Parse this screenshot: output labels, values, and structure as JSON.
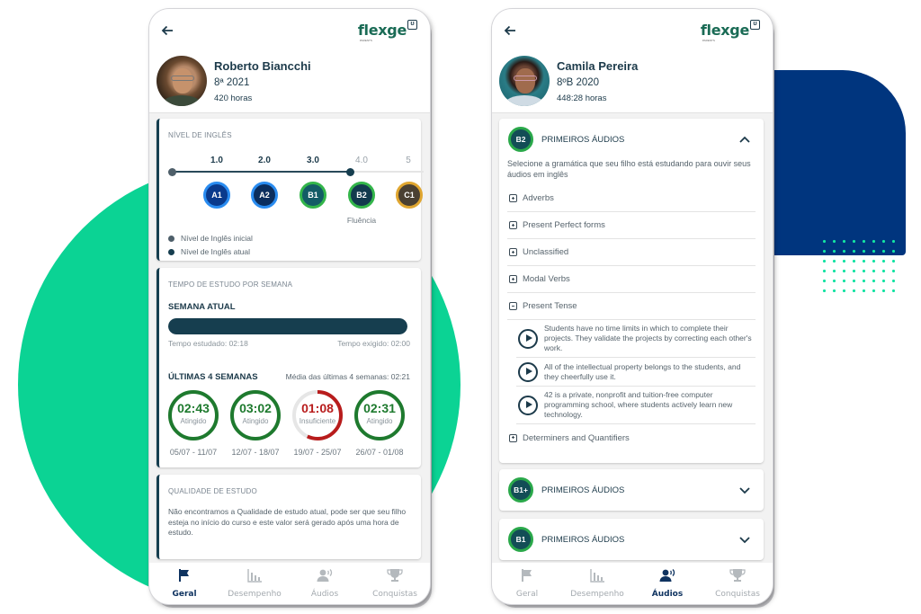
{
  "brand": {
    "logo_text": "flexge",
    "logo_sub": "PARENTS",
    "green": "#0bd394",
    "navy": "#00357e",
    "dark": "#163e4f"
  },
  "left_phone": {
    "user": {
      "name": "Roberto Biancchi",
      "class": "8ª 2021",
      "hours": "420 horas"
    },
    "level_card": {
      "title": "NÍVEL DE INGLÊS",
      "initial_level": 0.0,
      "current_level": 3.7,
      "scale": [
        "1.0",
        "2.0",
        "3.0",
        "4.0",
        "5"
      ],
      "levels": [
        {
          "code": "A1",
          "color": "#0a3a8c",
          "ring": "#2a8cf0"
        },
        {
          "code": "A2",
          "color": "#0b2e5e",
          "ring": "#2a8cf0"
        },
        {
          "code": "B1",
          "color": "#135c66",
          "ring": "#33b54a"
        },
        {
          "code": "B2",
          "color": "#123a4e",
          "ring": "#33b54a",
          "caption": "Fluência"
        },
        {
          "code": "C1",
          "color": "#4a4032",
          "ring": "#e0a630"
        }
      ],
      "legend": [
        {
          "label": "Nível de Inglês inicial",
          "color": "#4e5f6a"
        },
        {
          "label": "Nível de Inglês atual",
          "color": "#163e4f"
        }
      ]
    },
    "study_card": {
      "title": "TEMPO DE ESTUDO POR SEMANA",
      "current_week_label": "SEMANA ATUAL",
      "current_progress": 1.0,
      "studied": "Tempo estudado: 02:18",
      "required": "Tempo exigido: 02:00",
      "last_weeks_label": "ÚLTIMAS 4 SEMANAS",
      "average": "Média das últimas 4 semanas: 02:21",
      "weeks": [
        {
          "time": "02:43",
          "status": "Atingido",
          "range": "05/07 - 11/07",
          "progress": 1.0,
          "color": "#1e7a2e"
        },
        {
          "time": "03:02",
          "status": "Atingido",
          "range": "12/07 - 18/07",
          "progress": 1.0,
          "color": "#1e7a2e"
        },
        {
          "time": "01:08",
          "status": "Insuficiente",
          "range": "19/07 - 25/07",
          "progress": 0.57,
          "color": "#b81c1c"
        },
        {
          "time": "02:31",
          "status": "Atingido",
          "range": "26/07 - 01/08",
          "progress": 1.0,
          "color": "#1e7a2e"
        }
      ]
    },
    "quality_card": {
      "title": "QUALIDADE DE ESTUDO",
      "text": "Não encontramos a Qualidade de estudo atual, pode ser que seu filho esteja no início do curso e este valor será gerado após uma hora de estudo."
    },
    "nav": [
      {
        "label": "Geral",
        "icon": "flag-icon",
        "active": true
      },
      {
        "label": "Desempenho",
        "icon": "bar-chart-icon",
        "active": false
      },
      {
        "label": "Áudios",
        "icon": "user-voice-icon",
        "active": false
      },
      {
        "label": "Conquistas",
        "icon": "trophy-icon",
        "active": false
      }
    ]
  },
  "right_phone": {
    "user": {
      "name": "Camila Pereira",
      "class": "8ºB 2020",
      "hours": "448:28 horas"
    },
    "sections": [
      {
        "badge": "B2",
        "title": "PRIMEIROS ÁUDIOS",
        "expanded": true,
        "description": "Selecione a gramática que seu filho está estudando para ouvir seus áudios em inglês",
        "grammar": [
          {
            "label": "Adverbs",
            "expanded": false
          },
          {
            "label": "Present Perfect forms",
            "expanded": false
          },
          {
            "label": "Unclassified",
            "expanded": false
          },
          {
            "label": "Modal Verbs",
            "expanded": false
          },
          {
            "label": "Present Tense",
            "expanded": true
          },
          {
            "label": "Determiners and Quantifiers",
            "expanded": false
          }
        ],
        "audios": [
          "Students have no time limits in which to complete their projects. They validate the projects by correcting each other's work.",
          "All of the intellectual property belongs to the students, and they cheerfully use it.",
          "42 is a private, nonprofit and tuition-free computer programming school, where students actively learn new technology."
        ]
      },
      {
        "badge": "B1+",
        "title": "PRIMEIROS ÁUDIOS",
        "expanded": false
      },
      {
        "badge": "B1",
        "title": "PRIMEIROS ÁUDIOS",
        "expanded": false
      }
    ],
    "nav": [
      {
        "label": "Geral",
        "icon": "flag-icon",
        "active": false
      },
      {
        "label": "Desempenho",
        "icon": "bar-chart-icon",
        "active": false
      },
      {
        "label": "Áudios",
        "icon": "user-voice-icon",
        "active": true
      },
      {
        "label": "Conquistas",
        "icon": "trophy-icon",
        "active": false
      }
    ]
  }
}
